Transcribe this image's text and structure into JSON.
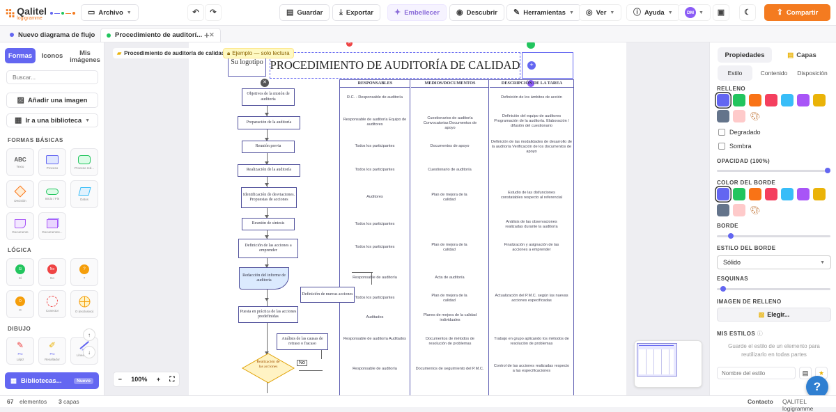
{
  "app": {
    "name": "Qalitel",
    "subname": "logigramme"
  },
  "topbar": {
    "archivo": "Archivo",
    "guardar": "Guardar",
    "exportar": "Exportar",
    "embellecer": "Embellecer",
    "descubrir": "Descubrir",
    "herramientas": "Herramientas",
    "ver": "Ver",
    "ayuda": "Ayuda",
    "avatar": "DM",
    "compartir": "Compartir"
  },
  "tabs": [
    {
      "label": "Nuevo diagrama de flujo"
    },
    {
      "label": "Procedimiento de auditorí..."
    }
  ],
  "left": {
    "tab_formas": "Formas",
    "tab_iconos": "Iconos",
    "tab_mis_imagenes": "Mis imágenes",
    "search_placeholder": "Buscar...",
    "add_image": "Añadir una imagen",
    "goto_library": "Ir a una biblioteca",
    "sec_basic": "FORMAS BÁSICAS",
    "sec_logic": "LÓGICA",
    "sec_draw": "DIBUJO",
    "basic_shapes": [
      {
        "label": "Texto",
        "glyph": "ABC"
      },
      {
        "label": "Proceso",
        "glyph": ""
      },
      {
        "label": "Proceso red...",
        "glyph": ""
      },
      {
        "label": "Decisión",
        "glyph": ""
      },
      {
        "label": "Inicio / Fin",
        "glyph": ""
      },
      {
        "label": "Datos",
        "glyph": ""
      },
      {
        "label": "Documento",
        "glyph": ""
      },
      {
        "label": "Documentos...",
        "glyph": ""
      }
    ],
    "logic_shapes": [
      {
        "label": "Sí",
        "glyph": "Sí",
        "color": "#22c55e"
      },
      {
        "label": "No",
        "glyph": "No",
        "color": "#ef4444"
      },
      {
        "label": "?",
        "glyph": "?",
        "color": "#f59e0b"
      },
      {
        "label": "O",
        "glyph": "O",
        "color": "#f59e0b"
      },
      {
        "label": "Conector",
        "glyph": "",
        "color": "#ef4444"
      },
      {
        "label": "O (exclusivo)",
        "glyph": "",
        "color": "#f59e0b"
      }
    ],
    "draw_shapes": [
      {
        "label": "Lápiz",
        "badge": "Pro"
      },
      {
        "label": "Resaltador",
        "badge": "Pro"
      },
      {
        "label": "Línea recta",
        "badge": "Pro"
      }
    ],
    "libraries": "Bibliotecas...",
    "libraries_badge": "Nuevo"
  },
  "canvas": {
    "breadcrumb": "Procedimiento de auditoría de calidad",
    "example_badge": "Ejemplo — solo lectura",
    "zoom": "100%",
    "logo": "Su logotipo",
    "title": "PROCEDIMIENTO DE AUDITORÍA DE CALIDAD",
    "headers": [
      "RESPONSABLES",
      "MEDIOS/DOCUMENTOS",
      "DESCRIPCIÓN DE LA TAREA"
    ],
    "steps": [
      "Objetivos de la misión de auditoría",
      "Preparación de la auditoría",
      "Reunión previa",
      "Realización de la auditoría",
      "Identificación de desviaciones. Propuestas de acciones",
      "Reunión de síntesis",
      "Definición de las acciones a emprender",
      "Redacción del informe de auditoría",
      "Definición de nuevas acciones",
      "Puesta en práctica de las acciones predefinidas",
      "Análisis de las causas de retraso o fracaso",
      "Realización de las acciones"
    ],
    "no_label": "No",
    "responsables": [
      "R.C. - Responsable de auditoría",
      "Responsable de auditoría Equipo de auditores",
      "Todos los participantes",
      "Todos los participantes",
      "Auditores",
      "Todos los participantes",
      "Todos los participantes",
      "Responsable de auditoría",
      "Todos los participantes",
      "Auditados",
      "Responsable de auditoría Auditados",
      "Responsable de auditoría"
    ],
    "medios": [
      "",
      "Cuestionarios de auditoría Convocatorias Documentos de apoyo",
      "Documentos de apoyo",
      "Cuestionario de auditoría",
      "Plan de mejora de la calidad",
      "",
      "Plan de mejora de la calidad",
      "Acta de auditoría",
      "Plan de mejora de la calidad",
      "Planes de mejora de la calidad individuales",
      "Documentos de métodos de resolución de problemas",
      "Documentos de seguimiento del P.M.C."
    ],
    "descripcion": [
      "Definición de los ámbitos de acción",
      "Definición del equipo de auditores Programación de la auditoría. Elaboración / difusión del cuestionario",
      "Definición de las modalidades de desarrollo de la auditoría Verificación de los documentos de apoyo",
      "",
      "Estudio de las disfunciones constatables respecto al referencial",
      "Análisis de las observaciones realizadas durante la auditoría",
      "Finalización y asignación de las acciones a emprender",
      "",
      "Actualización del P.M.C. según las nuevas acciones especificadas",
      "",
      "Trabajo en grupo aplicando los métodos de resolución de problemas",
      "Control de las acciones realizadas respecto a las especificaciones"
    ]
  },
  "right": {
    "tab_propiedades": "Propiedades",
    "tab_capas": "Capas",
    "sub_estilo": "Estilo",
    "sub_contenido": "Contenido",
    "sub_disposicion": "Disposición",
    "relleno": "RELLENO",
    "degradado": "Degradado",
    "sombra": "Sombra",
    "opacidad": "OPACIDAD (100%)",
    "opacity_value": 1.0,
    "color_borde": "COLOR DEL BORDE",
    "borde": "BORDE",
    "border_value": 0.1,
    "estilo_borde": "ESTILO DEL BORDE",
    "estilo_borde_value": "Sólido",
    "esquinas": "ESQUINAS",
    "corners_value": 0.03,
    "imagen_relleno": "IMAGEN DE RELLENO",
    "elegir": "Elegir...",
    "mis_estilos": "MIS ESTILOS",
    "estilos_hint": "Guarde el estilo de un elemento para reutilizarlo en todas partes",
    "estilo_placeholder": "Nombre del estilo",
    "colors": [
      "#6366f1",
      "#22c55e",
      "#f97316",
      "#f43f5e",
      "#38bdf8",
      "#a855f7",
      "#eab308",
      "#64748b",
      "#fecaca",
      "palette"
    ]
  },
  "status": {
    "elements_count": "67",
    "elements_label": "elementos",
    "layers_count": "3",
    "layers_label": "capas",
    "right1": "Contacto",
    "right2": "QALITEL logigramme"
  }
}
